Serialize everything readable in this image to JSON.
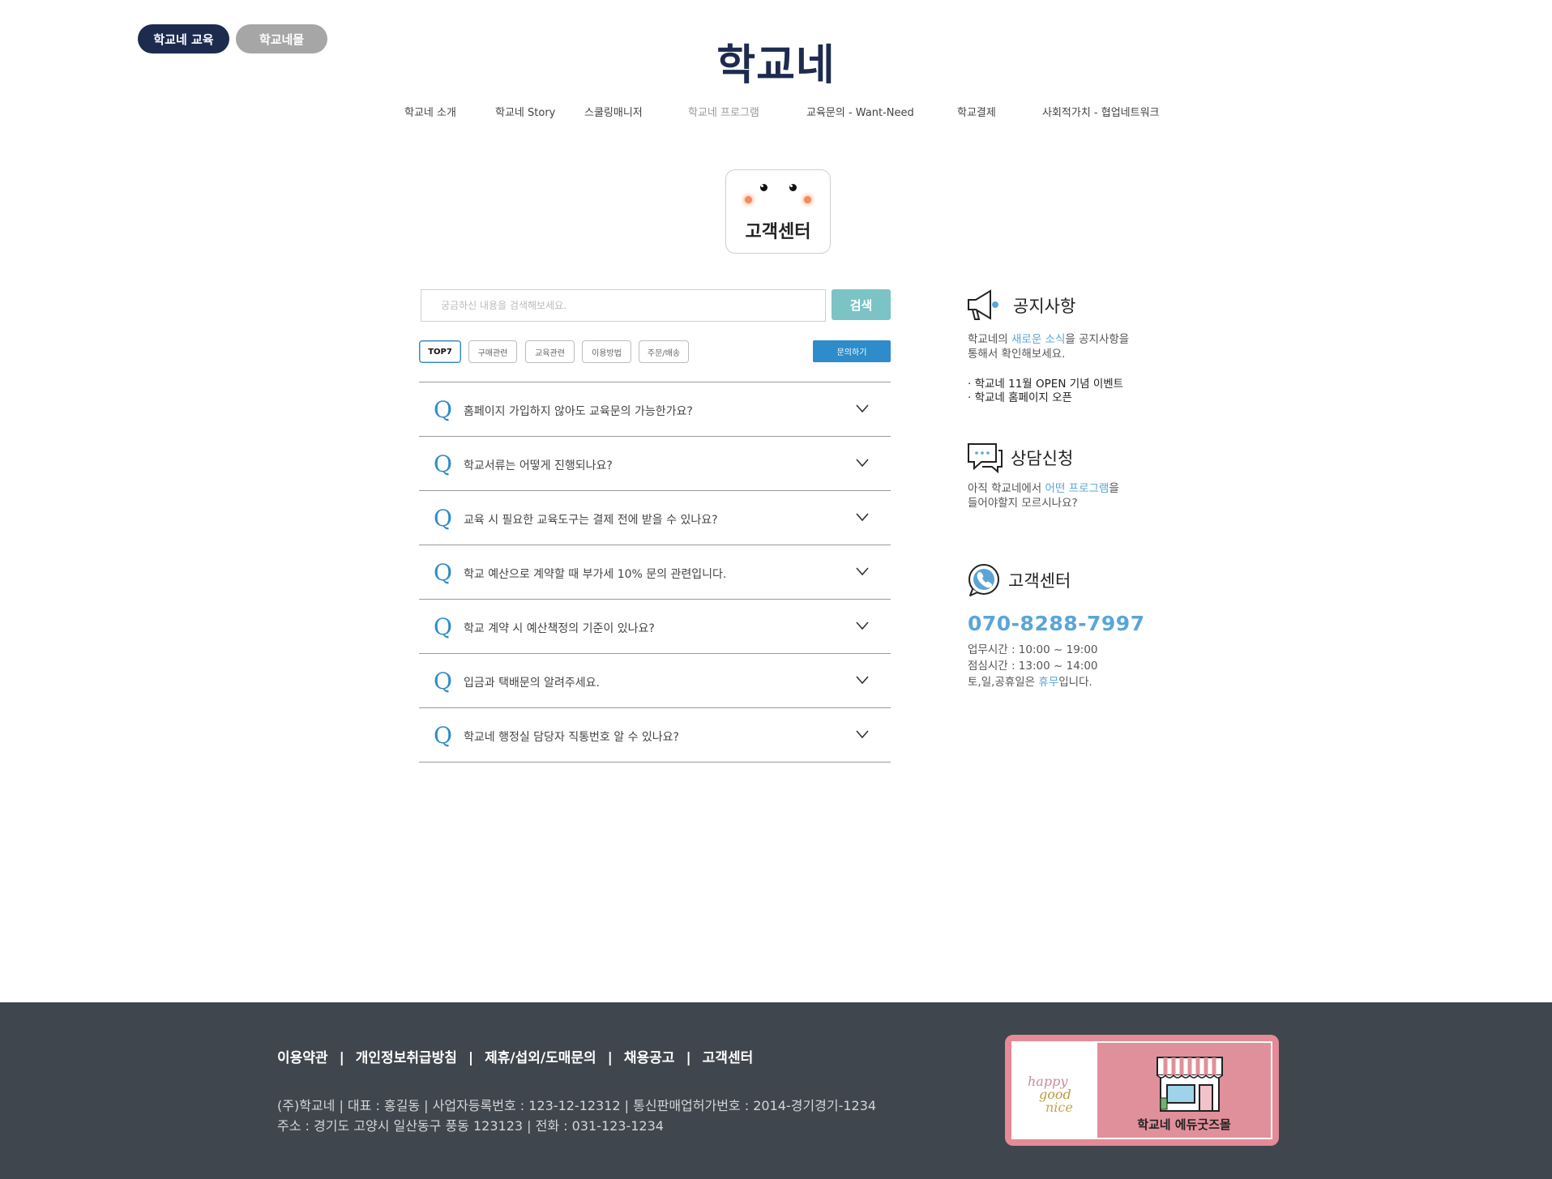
{
  "top_tabs": {
    "education": "학교네 교육",
    "mall": "학교네몰"
  },
  "logo": "학교네",
  "nav": [
    "학교네 소개",
    "학교네 Story",
    "스쿨링매니저",
    "학교네 프로그램",
    "교육문의 - Want-Need",
    "학교결제",
    "사회적가치 - 협업네트워크"
  ],
  "badge_title": "고객센터",
  "search": {
    "placeholder": "궁금하신 내용을 검색해보세요.",
    "button": "검색"
  },
  "tabs": [
    "TOP7",
    "구매관련",
    "교육관련",
    "이용방법",
    "주문/배송"
  ],
  "inquiry_button": "문의하기",
  "faq": {
    "q_mark": "Q",
    "items": [
      "홈페이지 가입하지 않아도 교육문의 가능한가요?",
      "학교서류는 어떻게 진행되나요?",
      "교육 시 필요한 교육도구는 결제 전에 받을 수 있나요?",
      "학교 예산으로 계약할 때 부가세 10% 문의 관련입니다.",
      "학교 계약 시 예산책정의 기준이 있나요?",
      "입금과 택배문의 알려주세요.",
      "학교네 행정실 담당자 직통번호 알 수 있나요?"
    ]
  },
  "notice": {
    "title": "공지사항",
    "desc1_a": "학교네의 ",
    "desc1_hl": "새로운 소식",
    "desc1_b": "을 공지사항을",
    "desc2": "통해서 확인해보세요.",
    "items": [
      "· 학교네 11월 OPEN 기념 이벤트",
      "· 학교네 홈페이지 오픈"
    ]
  },
  "consult": {
    "title": "상담신청",
    "desc1_a": "아직 학교네에서 ",
    "desc1_hl": "어떤 프로그램",
    "desc1_b": "을",
    "desc2": "들어야할지 모르시나요?"
  },
  "support": {
    "title": "고객센터",
    "phone": "070-8288-7997",
    "hours": "업무시간 : 10:00 ~ 19:00",
    "lunch": "점심시간 : 13:00 ~ 14:00",
    "holiday_a": "토,일,공휴일은 ",
    "holiday_hl": "휴무",
    "holiday_b": "입니다."
  },
  "footer": {
    "links": [
      "이용약관",
      "개인정보취급방침",
      "제휴/섭외/도매문의",
      "채용공고",
      "고객센터"
    ],
    "separator": "|",
    "info1": "(주)학교네   |   대표 : 홍길동   |   사업자등록번호 : 123-12-12312   |   통신판매업허가번호 : 2014-경기경기-1234",
    "info2": "주소 : 경기도 고양시 일산동구 풍동 123123   |   전화 : 031-123-1234",
    "mall_logo": [
      "happy",
      "good",
      "nice"
    ],
    "mall_label": "학교네 에듀굿즈몰"
  },
  "colors": {
    "navy": "#1d2b4f",
    "accent_blue": "#2d8cc9",
    "highlight": "#5aa5d8",
    "search_btn": "#7cc3c6",
    "footer_bg": "#3f464d",
    "mall_pink": "#e58a97"
  }
}
